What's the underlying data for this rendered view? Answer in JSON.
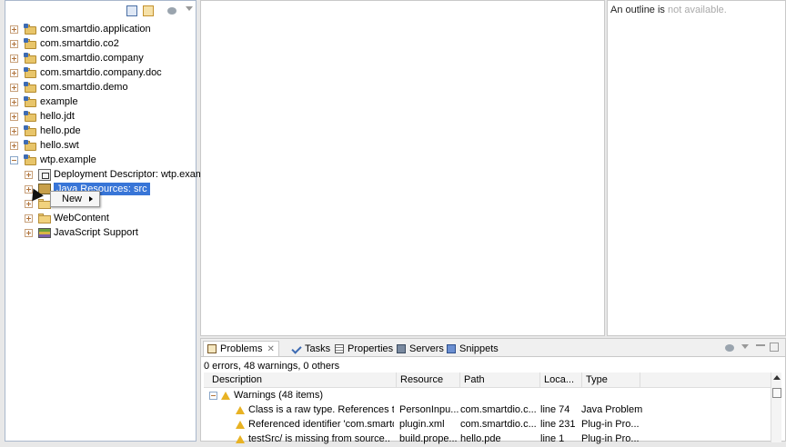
{
  "explorer": {
    "projects": [
      {
        "label": "com.smartdio.application",
        "state": "collapsed"
      },
      {
        "label": "com.smartdio.co2",
        "state": "collapsed"
      },
      {
        "label": "com.smartdio.company",
        "state": "collapsed"
      },
      {
        "label": "com.smartdio.company.doc",
        "state": "collapsed"
      },
      {
        "label": "com.smartdio.demo",
        "state": "collapsed"
      },
      {
        "label": "example",
        "state": "collapsed"
      },
      {
        "label": "hello.jdt",
        "state": "collapsed"
      },
      {
        "label": "hello.pde",
        "state": "collapsed"
      },
      {
        "label": "hello.swt",
        "state": "collapsed"
      },
      {
        "label": "wtp.example",
        "state": "expanded"
      }
    ],
    "children": [
      {
        "label": "Deployment Descriptor: wtp.examp",
        "icon": "deployment-descriptor-icon"
      },
      {
        "label": "Java Resources: src",
        "icon": "java-resources-icon",
        "selected": true
      },
      {
        "label": "",
        "icon": "folder-icon"
      },
      {
        "label": "WebContent",
        "icon": "folder-icon"
      },
      {
        "label": "JavaScript Support",
        "icon": "javascript-library-icon"
      }
    ]
  },
  "context_menu": {
    "items": [
      {
        "label": "New",
        "has_submenu": true
      }
    ]
  },
  "outline": {
    "text_visible": "An outline is",
    "text_obscured": "not available."
  },
  "problems": {
    "tabs": [
      {
        "label": "Problems",
        "active": true
      },
      {
        "label": "Tasks"
      },
      {
        "label": "Properties"
      },
      {
        "label": "Servers"
      },
      {
        "label": "Snippets"
      }
    ],
    "summary": "0 errors, 48 warnings, 0 others",
    "columns": [
      "Description",
      "Resource",
      "Path",
      "Loca...",
      "Type"
    ],
    "group": "Warnings (48 items)",
    "rows": [
      {
        "description": "Class is a raw type. References to ger",
        "resource": "PersonInpu...",
        "path": "com.smartdio.c...",
        "location": "line 74",
        "type": "Java Problem"
      },
      {
        "description": "Referenced identifier 'com.smartdio.",
        "resource": "plugin.xml",
        "path": "com.smartdio.c...",
        "location": "line 231",
        "type": "Plug-in Pro..."
      },
      {
        "description": "testSrc/ is missing from source..",
        "resource": "build.prope...",
        "path": "hello.pde",
        "location": "line 1",
        "type": "Plug-in Pro..."
      }
    ]
  },
  "colors": {
    "selection": "#3875d7",
    "warning": "#e8b223",
    "border_active": "#a9b8cc"
  }
}
